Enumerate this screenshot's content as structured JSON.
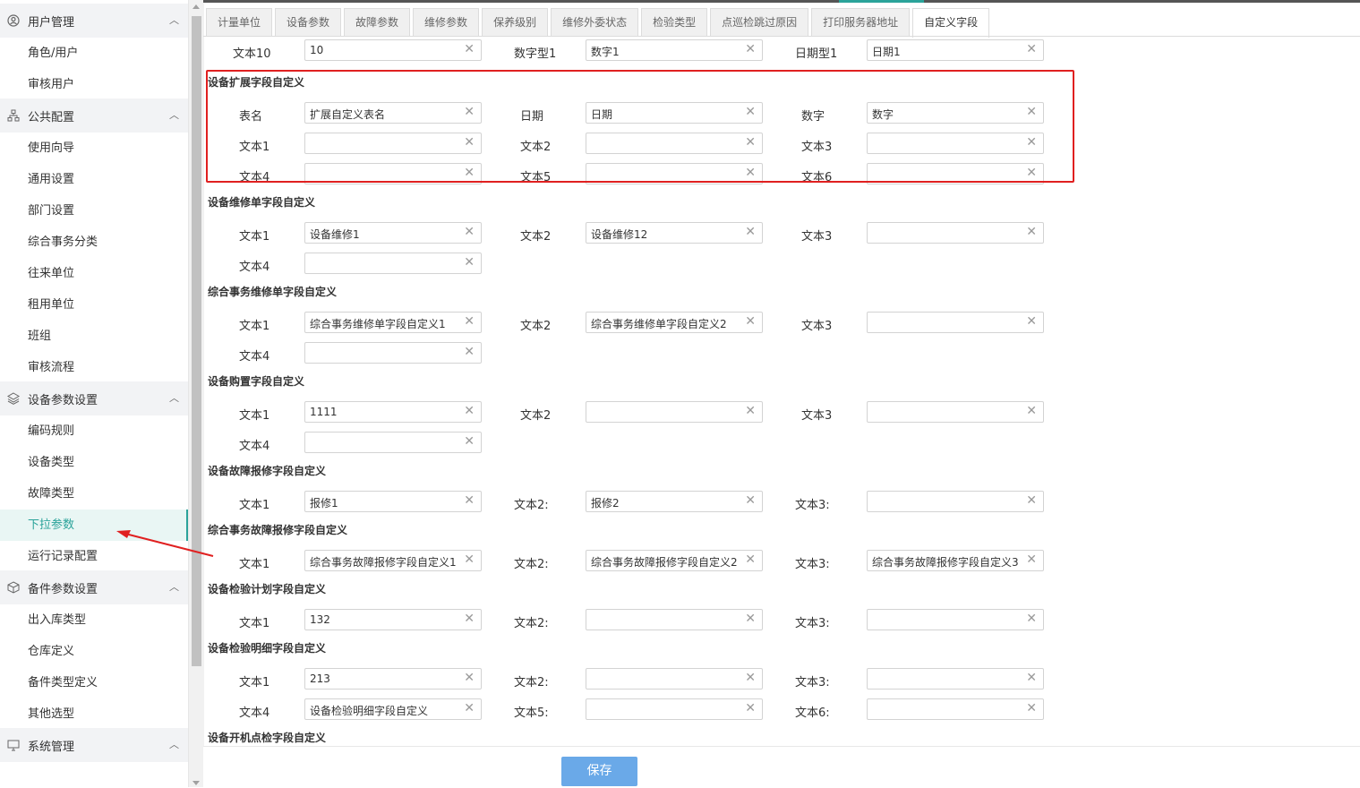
{
  "sidebar": {
    "sections": [
      {
        "title": "用户管理",
        "icon": "user-icon",
        "items": [
          "角色/用户",
          "审核用户"
        ]
      },
      {
        "title": "公共配置",
        "icon": "sitemap-icon",
        "items": [
          "使用向导",
          "通用设置",
          "部门设置",
          "综合事务分类",
          "往来单位",
          "租用单位",
          "班组",
          "审核流程"
        ]
      },
      {
        "title": "设备参数设置",
        "icon": "layers-icon",
        "items": [
          "编码规则",
          "设备类型",
          "故障类型",
          "下拉参数",
          "运行记录配置"
        ]
      },
      {
        "title": "备件参数设置",
        "icon": "box-icon",
        "items": [
          "出入库类型",
          "仓库定义",
          "备件类型定义",
          "其他选型"
        ]
      },
      {
        "title": "系统管理",
        "icon": "monitor-icon",
        "items": []
      }
    ],
    "active_item": "下拉参数"
  },
  "tabs": [
    "计量单位",
    "设备参数",
    "故障参数",
    "维修参数",
    "保养级别",
    "维修外委状态",
    "检验类型",
    "点巡检跳过原因",
    "打印服务器地址",
    "自定义字段"
  ],
  "active_tab": "自定义字段",
  "top_row": {
    "fields": [
      {
        "label": "文本10",
        "value": "10"
      },
      {
        "label": "数字型1",
        "value": "数字1"
      },
      {
        "label": "日期型1",
        "value": "日期1"
      }
    ]
  },
  "sections": [
    {
      "title": "设备扩展字段自定义",
      "rows": [
        [
          {
            "label": "表名",
            "value": "扩展自定义表名"
          },
          {
            "label": "日期",
            "value": "日期"
          },
          {
            "label": "数字",
            "value": "数字"
          }
        ],
        [
          {
            "label": "文本1",
            "value": ""
          },
          {
            "label": "文本2",
            "value": ""
          },
          {
            "label": "文本3",
            "value": ""
          }
        ],
        [
          {
            "label": "文本4",
            "value": ""
          },
          {
            "label": "文本5",
            "value": ""
          },
          {
            "label": "文本6",
            "value": ""
          }
        ]
      ]
    },
    {
      "title": "设备维修单字段自定义",
      "rows": [
        [
          {
            "label": "文本1",
            "value": "设备维修1"
          },
          {
            "label": "文本2",
            "value": "设备维修12"
          },
          {
            "label": "文本3",
            "value": ""
          }
        ],
        [
          {
            "label": "文本4",
            "value": ""
          }
        ]
      ]
    },
    {
      "title": "综合事务维修单字段自定义",
      "rows": [
        [
          {
            "label": "文本1",
            "value": "综合事务维修单字段自定义1"
          },
          {
            "label": "文本2",
            "value": "综合事务维修单字段自定义2"
          },
          {
            "label": "文本3",
            "value": ""
          }
        ],
        [
          {
            "label": "文本4",
            "value": ""
          }
        ]
      ]
    },
    {
      "title": "设备购置字段自定义",
      "rows": [
        [
          {
            "label": "文本1",
            "value": "1111"
          },
          {
            "label": "文本2",
            "value": ""
          },
          {
            "label": "文本3",
            "value": ""
          }
        ],
        [
          {
            "label": "文本4",
            "value": ""
          }
        ]
      ]
    },
    {
      "title": "设备故障报修字段自定义",
      "rows": [
        [
          {
            "label": "文本1",
            "value": "报修1"
          },
          {
            "label": "文本2:",
            "value": "报修2"
          },
          {
            "label": "文本3:",
            "value": ""
          }
        ]
      ]
    },
    {
      "title": "综合事务故障报修字段自定义",
      "rows": [
        [
          {
            "label": "文本1",
            "value": "综合事务故障报修字段自定义1"
          },
          {
            "label": "文本2:",
            "value": "综合事务故障报修字段自定义2"
          },
          {
            "label": "文本3:",
            "value": "综合事务故障报修字段自定义3"
          }
        ]
      ]
    },
    {
      "title": "设备检验计划字段自定义",
      "rows": [
        [
          {
            "label": "文本1",
            "value": "132"
          },
          {
            "label": "文本2:",
            "value": ""
          },
          {
            "label": "文本3:",
            "value": ""
          }
        ]
      ]
    },
    {
      "title": "设备检验明细字段自定义",
      "rows": [
        [
          {
            "label": "文本1",
            "value": "213"
          },
          {
            "label": "文本2:",
            "value": ""
          },
          {
            "label": "文本3:",
            "value": ""
          }
        ],
        [
          {
            "label": "文本4",
            "value": "设备检验明细字段自定义"
          },
          {
            "label": "文本5:",
            "value": ""
          },
          {
            "label": "文本6:",
            "value": ""
          }
        ]
      ]
    },
    {
      "title": "设备开机点检字段自定义",
      "rows": []
    }
  ],
  "save_label": "保存",
  "colors": {
    "accent": "#2ba39a",
    "highlight_box": "#e02020",
    "save_button": "#6aa9e8"
  }
}
